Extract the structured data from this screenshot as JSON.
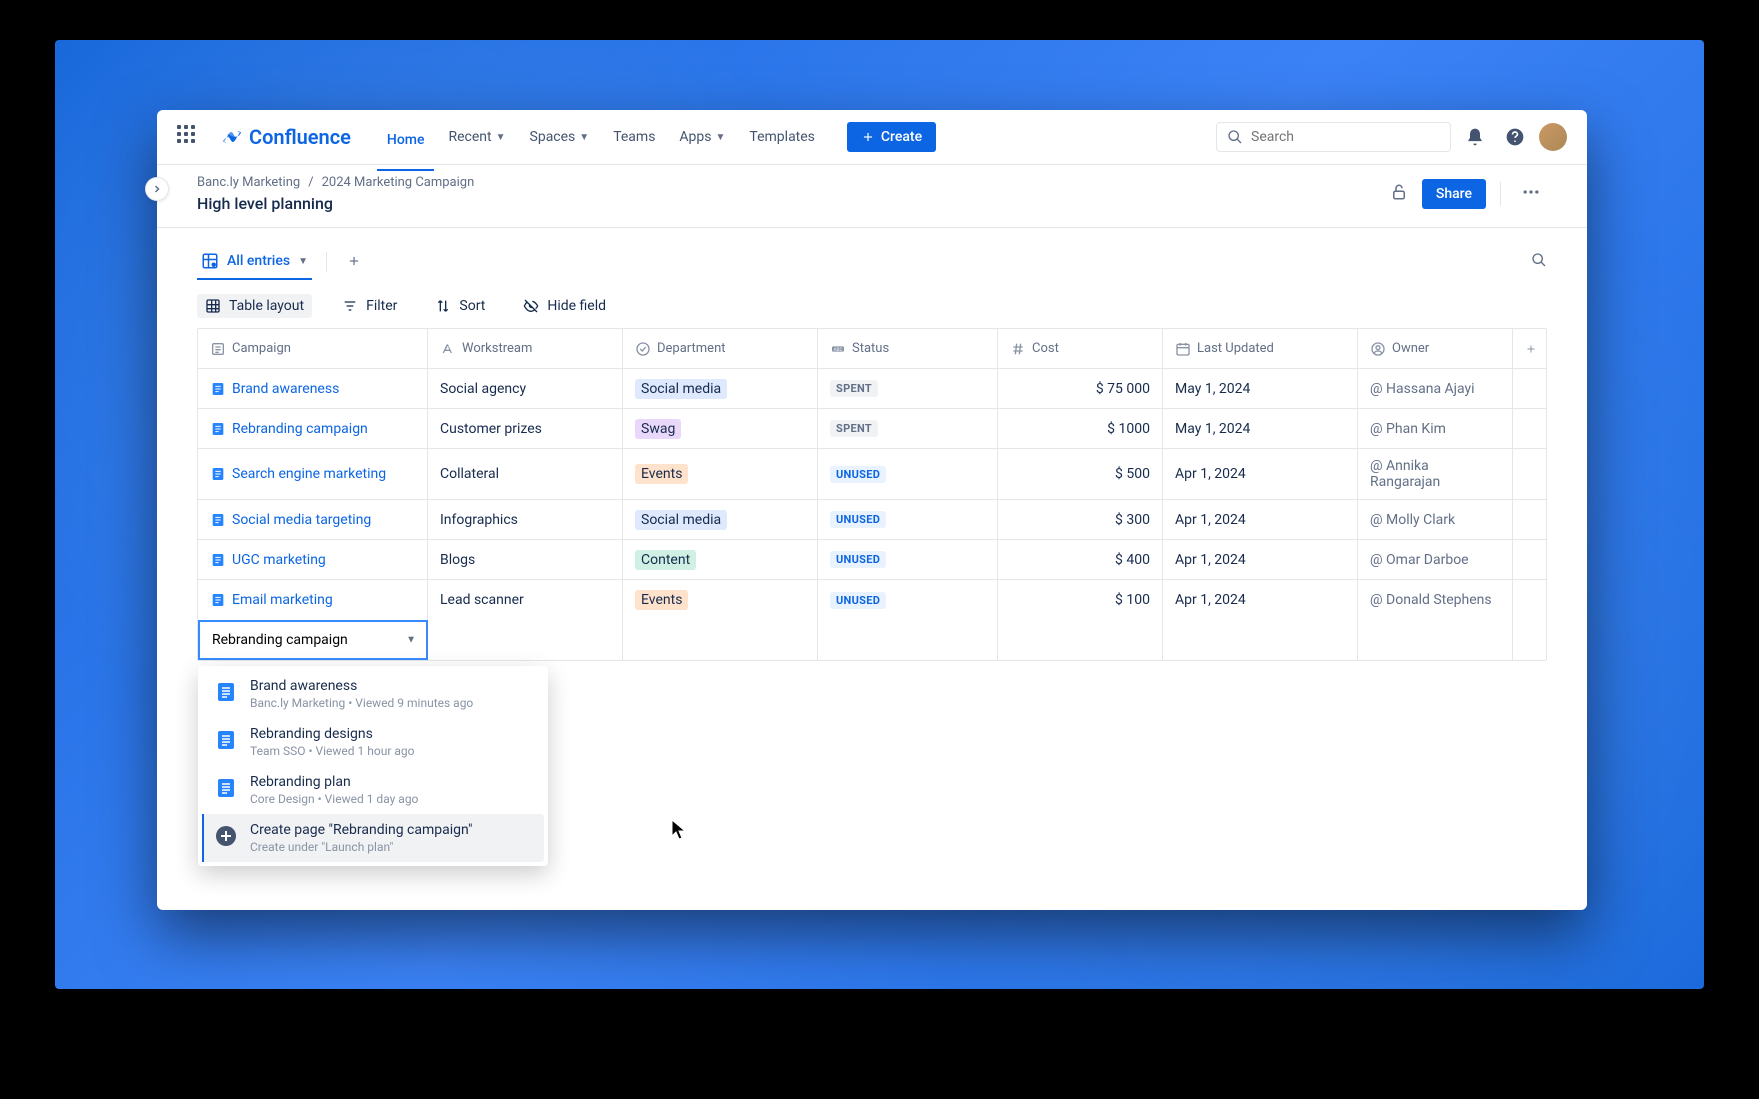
{
  "app": {
    "name": "Confluence"
  },
  "nav": {
    "items": [
      "Home",
      "Recent",
      "Spaces",
      "Teams",
      "Apps",
      "Templates"
    ],
    "active_index": 0,
    "dropdown_indices": [
      1,
      2,
      4
    ],
    "create_label": "Create"
  },
  "search": {
    "placeholder": "Search"
  },
  "breadcrumb": {
    "space": "Banc.ly Marketing",
    "page": "2024 Marketing Campaign"
  },
  "page": {
    "title": "High level planning",
    "share_label": "Share"
  },
  "view": {
    "tab_label": "All entries"
  },
  "toolbar": {
    "layout": "Table layout",
    "filter": "Filter",
    "sort": "Sort",
    "hide": "Hide field"
  },
  "columns": [
    "Campaign",
    "Workstream",
    "Department",
    "Status",
    "Cost",
    "Last Updated",
    "Owner"
  ],
  "rows": [
    {
      "campaign": "Brand awareness",
      "workstream": "Social agency",
      "department": "Social media",
      "dept_class": "dept-social",
      "status": "SPENT",
      "status_class": "status-spent",
      "cost": "$ 75 000",
      "updated": "May 1, 2024",
      "owner": "Hassana Ajayi"
    },
    {
      "campaign": "Rebranding campaign",
      "workstream": "Customer prizes",
      "department": "Swag",
      "dept_class": "dept-swag",
      "status": "SPENT",
      "status_class": "status-spent",
      "cost": "$ 1000",
      "updated": "May 1, 2024",
      "owner": "Phan Kim"
    },
    {
      "campaign": "Search engine marketing",
      "workstream": "Collateral",
      "department": "Events",
      "dept_class": "dept-events",
      "status": "UNUSED",
      "status_class": "status-unused",
      "cost": "$ 500",
      "updated": "Apr 1, 2024",
      "owner": "Annika Rangarajan"
    },
    {
      "campaign": "Social media targeting",
      "workstream": "Infographics",
      "department": "Social media",
      "dept_class": "dept-social",
      "status": "UNUSED",
      "status_class": "status-unused",
      "cost": "$ 300",
      "updated": "Apr 1, 2024",
      "owner": "Molly Clark"
    },
    {
      "campaign": "UGC marketing",
      "workstream": "Blogs",
      "department": "Content",
      "dept_class": "dept-content",
      "status": "UNUSED",
      "status_class": "status-unused",
      "cost": "$ 400",
      "updated": "Apr 1, 2024",
      "owner": "Omar Darboe"
    },
    {
      "campaign": "Email marketing",
      "workstream": "Lead scanner",
      "department": "Events",
      "dept_class": "dept-events",
      "status": "UNUSED",
      "status_class": "status-unused",
      "cost": "$ 100",
      "updated": "Apr 1, 2024",
      "owner": "Donald Stephens"
    }
  ],
  "new_row": {
    "input_value": "Rebranding campaign"
  },
  "autocomplete": {
    "items": [
      {
        "title": "Brand awareness",
        "meta": "Banc.ly Marketing   •   Viewed 9 minutes ago",
        "type": "doc"
      },
      {
        "title": "Rebranding designs",
        "meta": "Team SSO   •   Viewed 1 hour ago",
        "type": "doc"
      },
      {
        "title": "Rebranding plan",
        "meta": "Core Design   •   Viewed 1 day ago",
        "type": "doc"
      },
      {
        "title": "Create page \"Rebranding campaign\"",
        "meta": "Create under \"Launch plan\"",
        "type": "create"
      }
    ]
  }
}
